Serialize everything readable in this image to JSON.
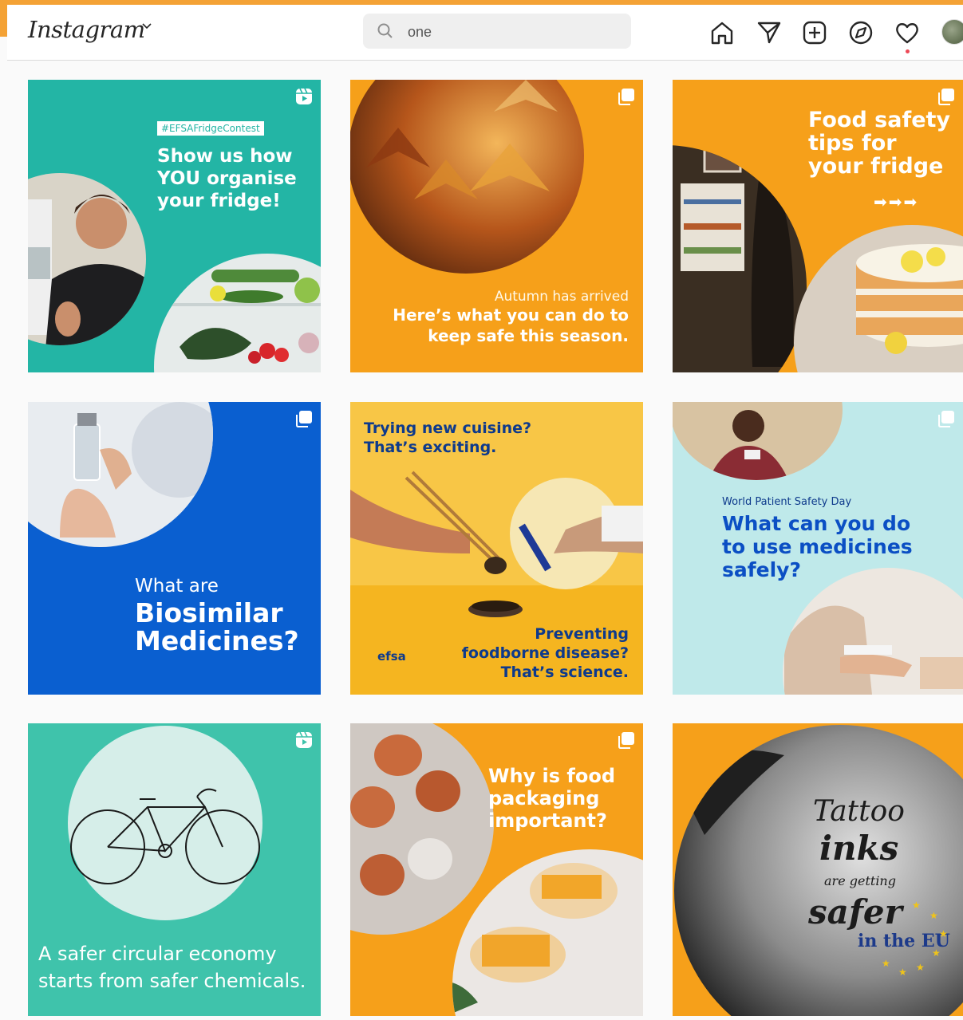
{
  "app": {
    "logo": "Instagram"
  },
  "search": {
    "value": "one",
    "placeholder": "Search"
  },
  "posts": [
    {
      "hashtag": "#EFSAFridgeContest",
      "headline": "Show us how YOU organise your fridge!",
      "badge": "reels-icon",
      "bg": "#23b5a5"
    },
    {
      "subtitle": "Autumn has arrived",
      "headline_l1": "Here’s what you can do to",
      "headline_l2": "keep safe this season.",
      "badge": "carousel-icon",
      "bg": "#f6a01a"
    },
    {
      "headline_l1": "Food safety",
      "headline_l2": "tips for",
      "headline_l3": "your fridge",
      "arrows": "➡➡➡",
      "badge": "carousel-icon",
      "bg": "#f6a01a"
    },
    {
      "line1": "What are",
      "line2": "Biosimilar",
      "line3": "Medicines?",
      "badge": "carousel-icon",
      "bg": "#0a5fd0"
    },
    {
      "top_l1": "Trying new cuisine?",
      "top_l2": "That’s exciting.",
      "bottom_l1": "Preventing",
      "bottom_l2": "foodborne disease?",
      "bottom_l3": "That’s science.",
      "logo": "efsa",
      "badge": "carousel-icon",
      "bg": "#f8c646"
    },
    {
      "kicker": "World Patient Safety Day",
      "headline_l1": "What can you do",
      "headline_l2": "to use medicines",
      "headline_l3": "safely?",
      "badge": "carousel-icon",
      "bg": "#bfe9ea"
    },
    {
      "line1": "A safer circular economy",
      "line2": "starts from safer chemicals.",
      "badge": "reels-icon",
      "bg": "#3fc3ab"
    },
    {
      "headline_l1": "Why is food",
      "headline_l2": "packaging",
      "headline_l3": "important?",
      "badge": "carousel-icon",
      "bg": "#f6a01a"
    },
    {
      "tattoo_l1": "Tattoo",
      "tattoo_l2": "inks",
      "tattoo_l3": "are getting",
      "tattoo_l4": "safer",
      "tattoo_l5": "in the EU",
      "bg": "#f6a01a"
    }
  ]
}
